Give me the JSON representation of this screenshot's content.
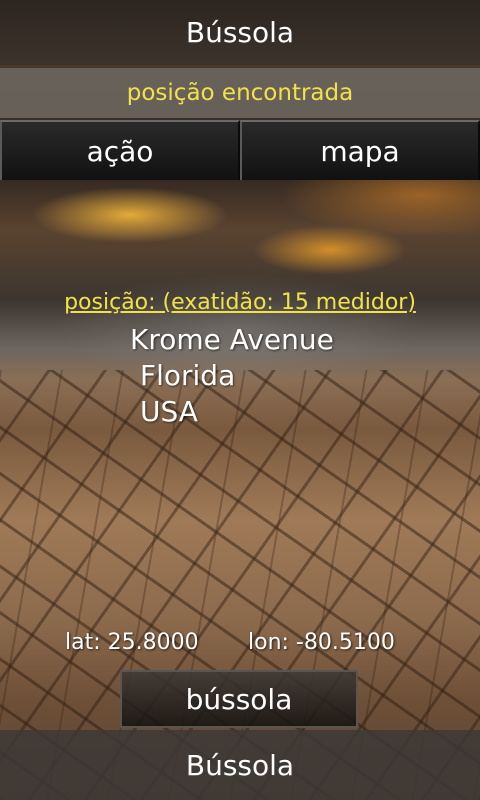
{
  "header": {
    "title": "Bússola"
  },
  "status": {
    "text": "posição encontrada"
  },
  "tabs": [
    {
      "label": "ação"
    },
    {
      "label": "mapa"
    }
  ],
  "position": {
    "heading": "posição: (exatidão: 15 medidor)",
    "address_lines": [
      "Krome Avenue",
      "Florida",
      "USA"
    ]
  },
  "coordinates": {
    "lat_text": "lat: 25.8000",
    "lon_text": "lon: -80.5100"
  },
  "compass_button": {
    "label": "bússola"
  },
  "footer": {
    "title": "Bússola"
  },
  "colors": {
    "status_text": "#f2e24a",
    "heading_text": "#f2e24a",
    "tab_background": "#111111"
  }
}
